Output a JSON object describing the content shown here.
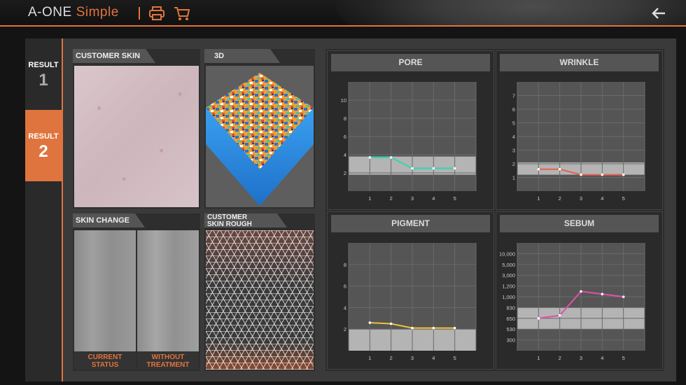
{
  "header": {
    "brand": "A-ONE",
    "brand_suffix": "Simple",
    "icons": [
      "printer-icon",
      "cart-icon",
      "arrow-left-icon"
    ]
  },
  "tabs": [
    {
      "title": "RESULT",
      "number": "1",
      "active": false
    },
    {
      "title": "RESULT",
      "number": "2",
      "active": true
    }
  ],
  "panels": {
    "customer_skin": "CUSTOMER SKIN",
    "three_d": "3D",
    "skin_change": "SKIN CHANGE",
    "skin_change_left": "CURRENT\nSTATUS",
    "skin_change_right": "WITHOUT\nTREATMENT",
    "skin_rough_line1": "CUSTOMER",
    "skin_rough_line2": "SKIN ROUGH"
  },
  "colors": {
    "accent": "#e0743e",
    "pore": "#2fd6b0",
    "wrinkle": "#e8604f",
    "pigment": "#f0c03a",
    "sebum": "#e050b0"
  },
  "chart_data": [
    {
      "type": "line",
      "title": "PORE",
      "x": [
        1,
        2,
        3,
        4,
        5
      ],
      "values": [
        3.7,
        3.7,
        2.5,
        2.5,
        2.5
      ],
      "yticks": [
        "10",
        "8",
        "6",
        "4",
        "2"
      ],
      "ylim": [
        0,
        12
      ],
      "band": [
        1.8,
        3.8
      ],
      "color": "#2fd6b0"
    },
    {
      "type": "line",
      "title": "WRINKLE",
      "x": [
        1,
        2,
        3,
        4,
        5
      ],
      "values": [
        1.6,
        1.6,
        1.2,
        1.2,
        1.2
      ],
      "yticks": [
        "7",
        "6",
        "5",
        "4",
        "3",
        "2",
        "1"
      ],
      "ylim": [
        0,
        8
      ],
      "band": [
        1.2,
        2.1
      ],
      "color": "#e8604f"
    },
    {
      "type": "line",
      "title": "PIGMENT",
      "x": [
        1,
        2,
        3,
        4,
        5
      ],
      "values": [
        2.6,
        2.5,
        2.1,
        2.1,
        2.1
      ],
      "yticks": [
        "8",
        "6",
        "4",
        "2"
      ],
      "ylim": [
        0,
        10
      ],
      "band": [
        0,
        2
      ],
      "color": "#f0c03a"
    },
    {
      "type": "line",
      "title": "SEBUM",
      "x": [
        1,
        2,
        3,
        4,
        5
      ],
      "values": [
        650,
        700,
        1100,
        1050,
        1000
      ],
      "yticks": [
        "10,000",
        "5,000",
        "3,000",
        "1,200",
        "1,000",
        "830",
        "650",
        "530",
        "300"
      ],
      "band": [
        530,
        830
      ],
      "color": "#e050b0"
    }
  ]
}
